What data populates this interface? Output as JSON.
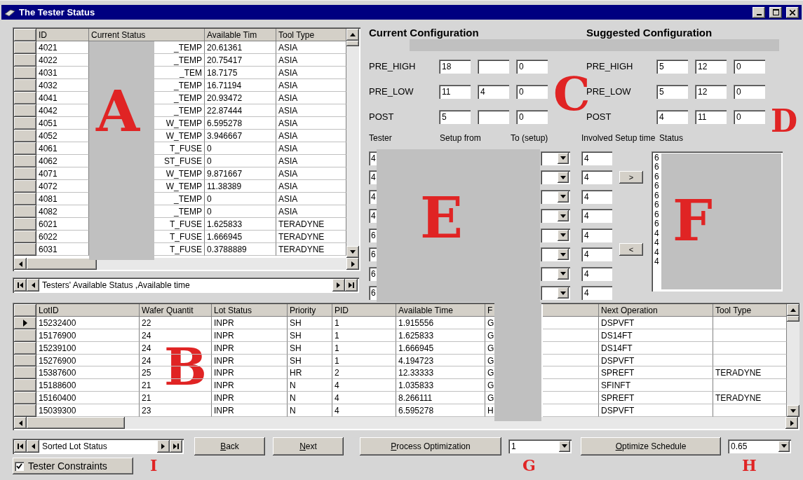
{
  "window": {
    "title": "The Tester Status"
  },
  "tester_table": {
    "annotation": "A",
    "columns": [
      "ID",
      "Current Status",
      "Available Tim",
      "Tool Type"
    ],
    "rows": [
      {
        "cells": [
          "4021",
          "_TEMP",
          "20.61361",
          "ASIA"
        ]
      },
      {
        "cells": [
          "4022",
          "_TEMP",
          "20.75417",
          "ASIA"
        ]
      },
      {
        "cells": [
          "4031",
          "_TEM",
          "18.7175",
          "ASIA"
        ]
      },
      {
        "cells": [
          "4032",
          "_TEMP",
          "16.71194",
          "ASIA"
        ]
      },
      {
        "cells": [
          "4041",
          "_TEMP",
          "20.93472",
          "ASIA"
        ]
      },
      {
        "cells": [
          "4042",
          "_TEMP",
          "22.87444",
          "ASIA"
        ]
      },
      {
        "cells": [
          "4051",
          "W_TEMP",
          "6.595278",
          "ASIA"
        ]
      },
      {
        "cells": [
          "4052",
          "W_TEMP",
          "3.946667",
          "ASIA"
        ]
      },
      {
        "cells": [
          "4061",
          "T_FUSE",
          "0",
          "ASIA"
        ]
      },
      {
        "cells": [
          "4062",
          "ST_FUSE",
          "0",
          "ASIA"
        ]
      },
      {
        "cells": [
          "4071",
          "W_TEMP",
          "9.871667",
          "ASIA"
        ]
      },
      {
        "cells": [
          "4072",
          "W_TEMP",
          "11.38389",
          "ASIA"
        ]
      },
      {
        "cells": [
          "4081",
          "_TEMP",
          "0",
          "ASIA"
        ]
      },
      {
        "cells": [
          "4082",
          "_TEMP",
          "0",
          "ASIA"
        ]
      },
      {
        "cells": [
          "6021",
          "T_FUSE",
          "1.625833",
          "TERADYNE"
        ]
      },
      {
        "cells": [
          "6022",
          "T_FUSE",
          "1.666945",
          "TERADYNE"
        ]
      },
      {
        "cells": [
          "6031",
          "T_FUSE",
          "0.3788889",
          "TERADYNE"
        ]
      }
    ]
  },
  "tester_navigator": {
    "caption": "Testers' Available Status ,Available time"
  },
  "current_configuration": {
    "title": "Current Configuration",
    "annotation": "C",
    "rows": [
      {
        "label": "PRE_HIGH",
        "field_1": "18",
        "field_3": "0"
      },
      {
        "label": "PRE_LOW",
        "field_1": "11",
        "field_2": "4",
        "field_3": "0"
      },
      {
        "label": "POST",
        "field_1": "5",
        "field_3": "0"
      }
    ]
  },
  "suggested_configuration": {
    "title": "Suggested Configuration",
    "annotation": "D",
    "rows": [
      {
        "label": "PRE_HIGH",
        "field_1": "5",
        "field_2": "12",
        "field_3": "0"
      },
      {
        "label": "PRE_LOW",
        "field_1": "5",
        "field_2": "12",
        "field_3": "0"
      },
      {
        "label": "POST",
        "field_1": "4",
        "field_2": "11",
        "field_3": "0"
      }
    ]
  },
  "setup": {
    "headers": [
      "Tester",
      "Setup from",
      "To (setup)",
      "Involved Setup time",
      "Status"
    ],
    "annotation": "E",
    "rows": [
      {
        "tester": "4",
        "setup_time": "4"
      },
      {
        "tester": "4",
        "setup_time": "4"
      },
      {
        "tester": "4",
        "setup_time": "4"
      },
      {
        "tester": "4",
        "setup_time": "4"
      },
      {
        "tester": "6",
        "setup_time": "4"
      },
      {
        "tester": "6",
        "setup_time": "4"
      },
      {
        "tester": "6",
        "setup_time": "4"
      },
      {
        "tester": "6",
        "setup_time": "4"
      }
    ],
    "move_buttons": [
      ">",
      "<"
    ],
    "status_list": {
      "annotation": "F",
      "items": [
        "6",
        "6",
        "6",
        "6",
        "6",
        "6",
        "6",
        "6",
        "4",
        "4",
        "4",
        "4"
      ]
    }
  },
  "lots_table": {
    "annotation": "B",
    "columns": [
      "LotID",
      "Wafer Quantit",
      "Lot Status",
      "Priority",
      "PID",
      "Available Time",
      "F",
      "Next Operation",
      "Tool Type"
    ],
    "rows": [
      {
        "selected": true,
        "cells": [
          "15232400",
          "22",
          "INPR",
          "SH",
          "1",
          "1.915556",
          "G",
          "DSPVFT"
        ]
      },
      {
        "selected": false,
        "cells": [
          "15176900",
          "24",
          "INPR",
          "SH",
          "1",
          "1.625833",
          "G",
          "DS14FT"
        ]
      },
      {
        "selected": false,
        "cells": [
          "15239100",
          "24",
          "INPR",
          "SH",
          "1",
          "1.666945",
          "G",
          "DS14FT"
        ]
      },
      {
        "selected": false,
        "cells": [
          "15276900",
          "24",
          "INPR",
          "SH",
          "1",
          "4.194723",
          "G",
          "DSPVFT"
        ]
      },
      {
        "selected": false,
        "cells": [
          "15387600",
          "25",
          "INPR",
          "HR",
          "2",
          "12.33333",
          "G",
          "SPREFT"
        ],
        "tool_type": "TERADYNE"
      },
      {
        "selected": false,
        "cells": [
          "15188600",
          "21",
          "INPR",
          "N",
          "4",
          "1.035833",
          "G",
          "SFINFT"
        ]
      },
      {
        "selected": false,
        "cells": [
          "15160400",
          "21",
          "INPR",
          "N",
          "4",
          "8.266111",
          "G",
          "SPREFT"
        ],
        "tool_type": "TERADYNE"
      },
      {
        "selected": false,
        "cells": [
          "15039300",
          "23",
          "INPR",
          "N",
          "4",
          "6.595278",
          "H",
          "DSPVFT"
        ]
      }
    ]
  },
  "bottom": {
    "navigator": {
      "caption": "Sorted Lot Status",
      "annotation": "I"
    },
    "buttons": [
      "Back",
      "Next",
      "Process Optimization"
    ],
    "process_combo": {
      "value": "1",
      "annotation": "G"
    },
    "optimize_button": "Optimize Schedule",
    "ratio_combo": {
      "value": "0.65",
      "annotation": "H"
    },
    "tester_constraints": {
      "label": "Tester Constraints",
      "checked": true
    }
  }
}
